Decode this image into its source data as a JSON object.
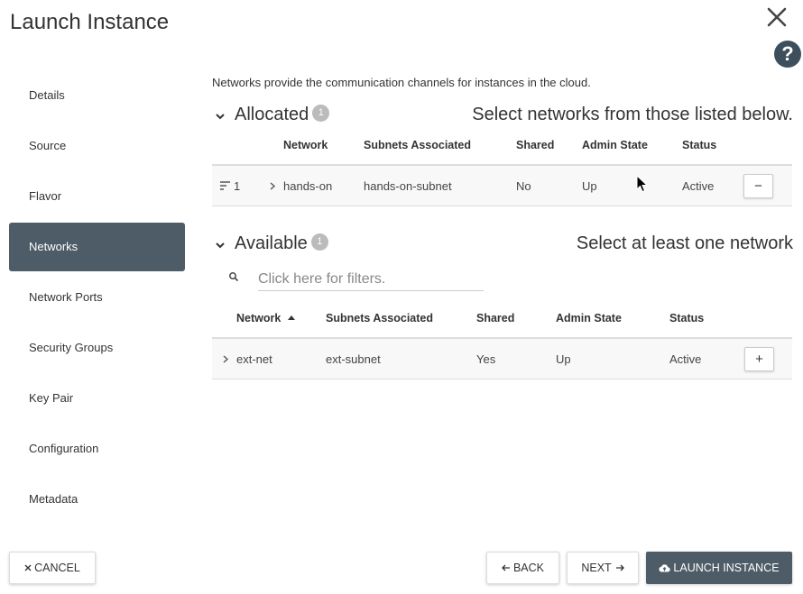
{
  "dialog": {
    "title": "Launch Instance",
    "help_symbol": "?"
  },
  "sidebar": {
    "items": [
      {
        "label": "Details"
      },
      {
        "label": "Source"
      },
      {
        "label": "Flavor"
      },
      {
        "label": "Networks",
        "active": true
      },
      {
        "label": "Network Ports"
      },
      {
        "label": "Security Groups"
      },
      {
        "label": "Key Pair"
      },
      {
        "label": "Configuration"
      },
      {
        "label": "Metadata"
      }
    ]
  },
  "main": {
    "description": "Networks provide the communication channels for instances in the cloud.",
    "allocated": {
      "title": "Allocated",
      "count": "1",
      "hint": "Select networks from those listed below.",
      "columns": [
        "Network",
        "Subnets Associated",
        "Shared",
        "Admin State",
        "Status"
      ],
      "rows": [
        {
          "order": "1",
          "network": "hands-on",
          "subnets": "hands-on-subnet",
          "shared": "No",
          "admin_state": "Up",
          "status": "Active",
          "action": "−"
        }
      ]
    },
    "available": {
      "title": "Available",
      "count": "1",
      "hint": "Select at least one network",
      "filter_placeholder": "Click here for filters.",
      "columns": [
        "Network",
        "Subnets Associated",
        "Shared",
        "Admin State",
        "Status"
      ],
      "rows": [
        {
          "network": "ext-net",
          "subnets": "ext-subnet",
          "shared": "Yes",
          "admin_state": "Up",
          "status": "Active",
          "action": "+"
        }
      ]
    }
  },
  "footer": {
    "cancel_label": "CANCEL",
    "back_label": "BACK",
    "next_label": "NEXT",
    "launch_label": "LAUNCH INSTANCE"
  },
  "colors": {
    "accent": "#4d5c66",
    "help_bg": "#3d4f5c",
    "badge": "#bbbbbb"
  }
}
